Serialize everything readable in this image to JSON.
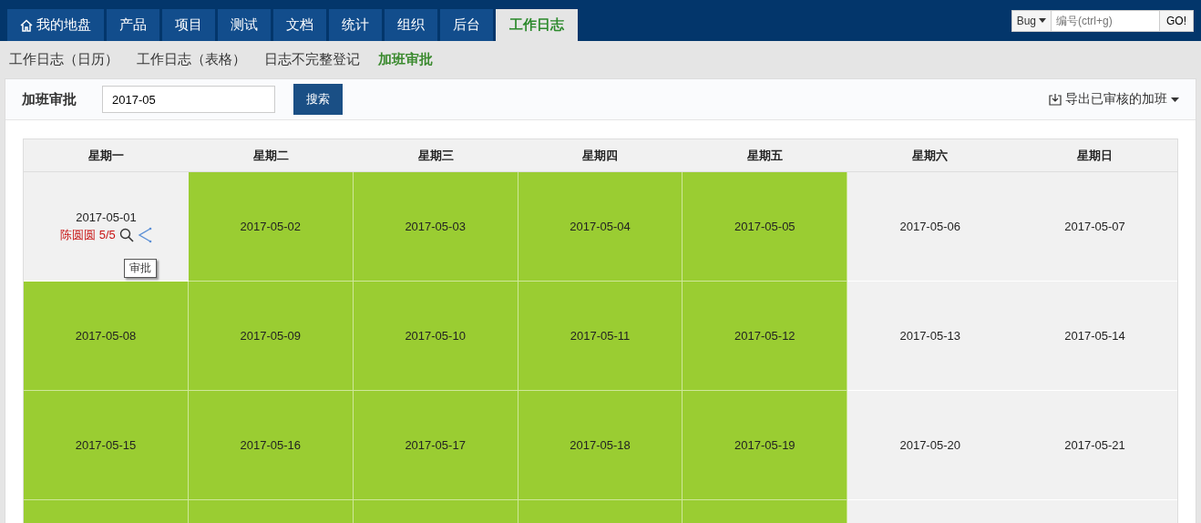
{
  "nav": {
    "tabs": [
      {
        "label": "我的地盘",
        "kind": "home",
        "selected": false
      },
      {
        "label": "产品",
        "kind": "module",
        "selected": false
      },
      {
        "label": "项目",
        "kind": "module",
        "selected": false
      },
      {
        "label": "测试",
        "kind": "module",
        "selected": false
      },
      {
        "label": "文档",
        "kind": "module",
        "selected": false
      },
      {
        "label": "统计",
        "kind": "module",
        "selected": false
      },
      {
        "label": "组织",
        "kind": "module",
        "selected": false
      },
      {
        "label": "后台",
        "kind": "module",
        "selected": false
      },
      {
        "label": "工作日志",
        "kind": "module",
        "selected": true
      }
    ],
    "quick_jump": {
      "type": "Bug",
      "placeholder": "编号(ctrl+g)",
      "button": "GO!"
    }
  },
  "subnav": [
    {
      "label": "工作日志（日历）",
      "selected": false
    },
    {
      "label": "工作日志（表格）",
      "selected": false
    },
    {
      "label": "日志不完整登记",
      "selected": false
    },
    {
      "label": "加班审批",
      "selected": true
    }
  ],
  "toolbar": {
    "title": "加班审批",
    "month_value": "2017-05",
    "search_button": "搜索",
    "export": "导出已审核的加班"
  },
  "calendar": {
    "columns": [
      "星期一",
      "星期二",
      "星期三",
      "星期四",
      "星期五",
      "星期六",
      "星期日"
    ],
    "rows": [
      [
        {
          "date": "2017-05-01",
          "highlighted": false,
          "entry": {
            "name": "陈圆圆",
            "count": "5/5",
            "tooltip": "审批"
          }
        },
        {
          "date": "2017-05-02",
          "highlighted": true
        },
        {
          "date": "2017-05-03",
          "highlighted": true
        },
        {
          "date": "2017-05-04",
          "highlighted": true
        },
        {
          "date": "2017-05-05",
          "highlighted": true
        },
        {
          "date": "2017-05-06",
          "highlighted": false
        },
        {
          "date": "2017-05-07",
          "highlighted": false
        }
      ],
      [
        {
          "date": "2017-05-08",
          "highlighted": true
        },
        {
          "date": "2017-05-09",
          "highlighted": true
        },
        {
          "date": "2017-05-10",
          "highlighted": true
        },
        {
          "date": "2017-05-11",
          "highlighted": true
        },
        {
          "date": "2017-05-12",
          "highlighted": true
        },
        {
          "date": "2017-05-13",
          "highlighted": false
        },
        {
          "date": "2017-05-14",
          "highlighted": false
        }
      ],
      [
        {
          "date": "2017-05-15",
          "highlighted": true
        },
        {
          "date": "2017-05-16",
          "highlighted": true
        },
        {
          "date": "2017-05-17",
          "highlighted": true
        },
        {
          "date": "2017-05-18",
          "highlighted": true
        },
        {
          "date": "2017-05-19",
          "highlighted": true
        },
        {
          "date": "2017-05-20",
          "highlighted": false
        },
        {
          "date": "2017-05-21",
          "highlighted": false
        }
      ],
      [
        {
          "highlighted": true
        },
        {
          "highlighted": true
        },
        {
          "highlighted": true
        },
        {
          "highlighted": true
        },
        {
          "highlighted": true
        },
        {
          "highlighted": false
        },
        {
          "highlighted": false
        }
      ]
    ]
  }
}
